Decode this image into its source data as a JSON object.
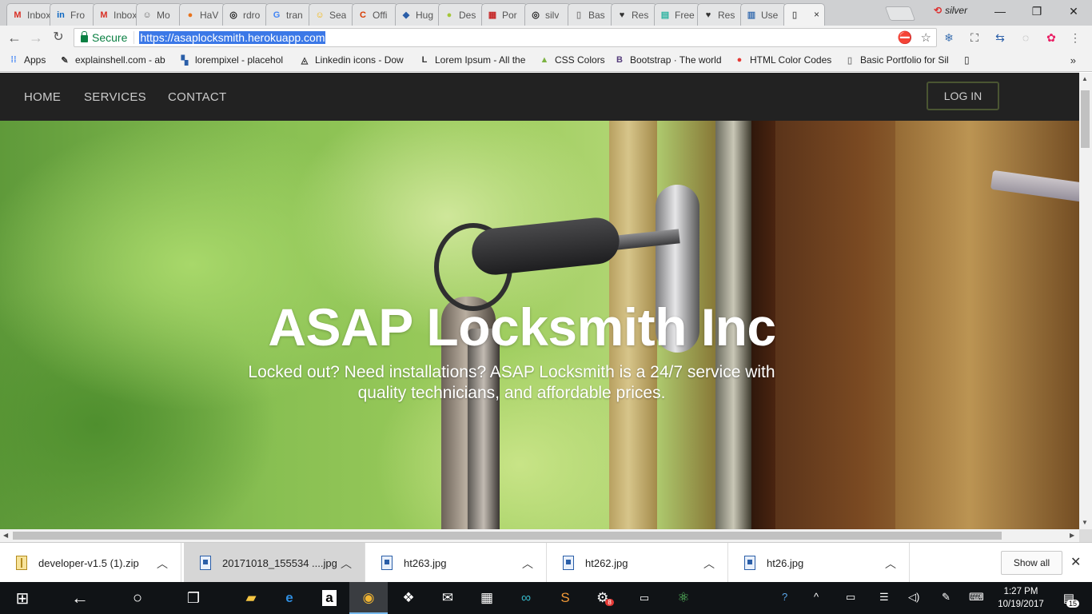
{
  "browser": {
    "tabs": [
      {
        "title": "Inbox",
        "icon": "gmail-icon",
        "color": "#d93025",
        "glyph": "M"
      },
      {
        "title": "Fro",
        "icon": "linkedin-icon",
        "color": "#0a66c2",
        "glyph": "in"
      },
      {
        "title": "Inbox",
        "icon": "gmail-icon",
        "color": "#d93025",
        "glyph": "M"
      },
      {
        "title": "Mo",
        "icon": "smiley-icon",
        "color": "#666666",
        "glyph": "☺"
      },
      {
        "title": "HaV",
        "icon": "pumpkin-icon",
        "color": "#e8731c",
        "glyph": "●"
      },
      {
        "title": "rdro",
        "icon": "github-icon",
        "color": "#222222",
        "glyph": "◎"
      },
      {
        "title": "tran",
        "icon": "google-icon",
        "color": "#4285f4",
        "glyph": "G"
      },
      {
        "title": "Sea",
        "icon": "emoji-icon",
        "color": "#f4b400",
        "glyph": "☺"
      },
      {
        "title": "Offi",
        "icon": "office-icon",
        "color": "#d83b01",
        "glyph": "C"
      },
      {
        "title": "Hug",
        "icon": "diamond-icon",
        "color": "#2a5ea8",
        "glyph": "◆"
      },
      {
        "title": "Des",
        "icon": "android-icon",
        "color": "#a4c639",
        "glyph": "●"
      },
      {
        "title": "Por",
        "icon": "clapper-icon",
        "color": "#c62828",
        "glyph": "▦"
      },
      {
        "title": "silv",
        "icon": "github-icon",
        "color": "#222222",
        "glyph": "◎"
      },
      {
        "title": "Bas",
        "icon": "page-icon",
        "color": "#888888",
        "glyph": "▯"
      },
      {
        "title": "Res",
        "icon": "heart-icon",
        "color": "#333333",
        "glyph": "♥"
      },
      {
        "title": "Free",
        "icon": "template-icon",
        "color": "#2bb3a0",
        "glyph": "▤"
      },
      {
        "title": "Res",
        "icon": "heart-icon",
        "color": "#333333",
        "glyph": "♥"
      },
      {
        "title": "Use",
        "icon": "chart-icon",
        "color": "#3a6fb0",
        "glyph": "▥"
      }
    ],
    "active_tab": {
      "close": "×"
    },
    "profile_name": "silver",
    "window_controls": [
      "—",
      "❐",
      "✕"
    ],
    "secure_label": "Secure",
    "url": "https://asaplocksmith.herokuapp.com",
    "bookmarks": [
      {
        "label": "Apps",
        "icon": "apps-grid-icon",
        "color": "#4285f4",
        "glyph": "⁞⁞"
      },
      {
        "label": "explainshell.com - ab",
        "icon": "shell-icon",
        "color": "#333333",
        "glyph": "✎"
      },
      {
        "label": "lorempixel - placehol",
        "icon": "pixel-icon",
        "color": "#2a5ea8",
        "glyph": "▚"
      },
      {
        "label": "Linkedin icons - Dow",
        "icon": "linkedin-icon",
        "color": "#333333",
        "glyph": "◬"
      },
      {
        "label": "Lorem Ipsum - All the",
        "icon": "lorem-icon",
        "color": "#333333",
        "glyph": "L"
      },
      {
        "label": "CSS Colors",
        "icon": "css-icon",
        "color": "#7cb342",
        "glyph": "▲"
      },
      {
        "label": "Bootstrap · The world",
        "icon": "bootstrap-icon",
        "color": "#563d7c",
        "glyph": "B"
      },
      {
        "label": "HTML Color Codes",
        "icon": "html-color-icon",
        "color": "#e53935",
        "glyph": "●"
      },
      {
        "label": "Basic Portfolio for Silv",
        "icon": "page-icon",
        "color": "#888888",
        "glyph": "▯"
      }
    ],
    "bookmarks_more": "»"
  },
  "site": {
    "nav": [
      "HOME",
      "SERVICES",
      "CONTACT"
    ],
    "login": "LOG IN",
    "hero_title": "ASAP Locksmith Inc",
    "hero_subtitle": "Locked out? Need installations? ASAP Locksmith is a 24/7 service with quality technicians, and affordable prices."
  },
  "downloads": {
    "items": [
      {
        "name": "developer-v1.5 (1).zip",
        "type": "zip"
      },
      {
        "name": "20171018_155534 ....jpg",
        "type": "image"
      },
      {
        "name": "ht263.jpg",
        "type": "image"
      },
      {
        "name": "ht262.jpg",
        "type": "image"
      },
      {
        "name": "ht26.jpg",
        "type": "image"
      }
    ],
    "show_all": "Show all"
  },
  "taskbar": {
    "time": "1:27 PM",
    "date": "10/19/2017",
    "notifications": "15",
    "app_badge": "8"
  }
}
